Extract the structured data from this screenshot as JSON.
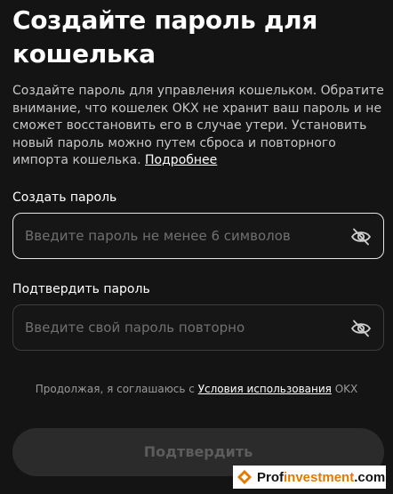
{
  "header": {
    "title": "Создайте пароль для кошелька"
  },
  "description": {
    "text": "Создайте пароль для управления кошельком. Обратите внимание, что кошелек OKX не хранит ваш пароль и не сможет восстановить его в случае утери. Установить новый пароль можно путем сброса и повторного импорта кошелька. ",
    "link_label": "Подробнее"
  },
  "create_password": {
    "label": "Создать пароль",
    "placeholder": "Введите пароль не менее 6 символов",
    "value": "",
    "icon": "eye-off-icon"
  },
  "confirm_password": {
    "label": "Подтвердить пароль",
    "placeholder": "Введите свой пароль повторно",
    "value": "",
    "icon": "eye-off-icon"
  },
  "terms": {
    "prefix": "Продолжая, я соглашаюсь с ",
    "link_label": "Условия использования",
    "suffix": " OKX"
  },
  "submit": {
    "label": "Подтвердить",
    "enabled": false
  },
  "watermark": {
    "text_prefix": "Prof",
    "text_accent": "investment",
    "text_suffix": ".com"
  },
  "colors": {
    "background": "#141414",
    "text_primary": "#ffffff",
    "text_secondary": "#c7c7c7",
    "placeholder": "#707070",
    "focused_border": "#e6e6e6",
    "idle_border": "#3d3d3d",
    "button_disabled_bg": "#2b2b2b",
    "button_disabled_text": "#5c5c5c"
  }
}
